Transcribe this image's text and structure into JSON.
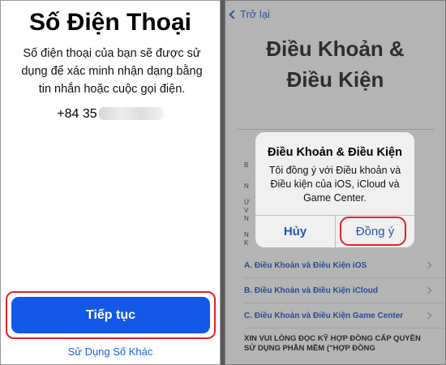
{
  "left": {
    "title": "Số Điện Thoại",
    "description": "Số điện thoại của bạn sẽ được sử dụng để xác minh nhận dạng bằng tin nhắn hoặc cuộc gọi điện.",
    "phone_prefix": "+84 35",
    "continue_label": "Tiếp tục",
    "other_link": "Sử Dụng Số Khác"
  },
  "right": {
    "back_label": "Trở lại",
    "title_line1": "Điều Khoản &",
    "title_line2": "Điều Kiện",
    "doc_letters": [
      "B",
      "N",
      "Ứ",
      "V",
      "N",
      "N",
      "K"
    ],
    "rows": [
      {
        "label": "A. Điều Khoản và Điều Kiện iOS"
      },
      {
        "label": "B. Điều Khoản và Điều Kiện iCloud"
      },
      {
        "label": "C. Điều Khoản và Điều Kiện Game Center"
      }
    ],
    "bold_paragraph": "XIN VUI LÒNG ĐỌC KỸ HỢP ĐỒNG CẤP QUYỀN SỬ DỤNG PHẦN MỀM (\"HỢP ĐỒNG",
    "alert": {
      "title": "Điều Khoản & Điều Kiện",
      "message": "Tôi đồng ý với Điều khoản và Điều kiện của iOS, iCloud và Game Center.",
      "cancel_label": "Hủy",
      "agree_label": "Đồng ý"
    }
  },
  "colors": {
    "primary_button": "#1358e6",
    "highlight": "#e2232a",
    "link": "#1a5fd6",
    "overlay_background": "#b4b4b4"
  }
}
